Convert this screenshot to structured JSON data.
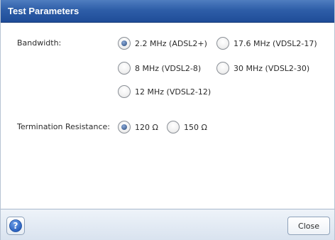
{
  "dialog": {
    "title": "Test Parameters"
  },
  "bandwidth": {
    "label": "Bandwidth:",
    "selected": "2.2 MHz (ADSL2+)",
    "options": [
      "2.2 MHz (ADSL2+)",
      "17.6 MHz (VDSL2-17)",
      "8 MHz (VDSL2-8)",
      "30 MHz (VDSL2-30)",
      "12 MHz (VDSL2-12)"
    ]
  },
  "termination": {
    "label": "Termination Resistance:",
    "selected": "120 Ω",
    "options": [
      "120 Ω",
      "150 Ω"
    ]
  },
  "footer": {
    "help_icon": "help-icon",
    "close_label": "Close"
  },
  "colors": {
    "titlebar": "#2e5ea8",
    "radio_selected": "#4f6f9f"
  }
}
